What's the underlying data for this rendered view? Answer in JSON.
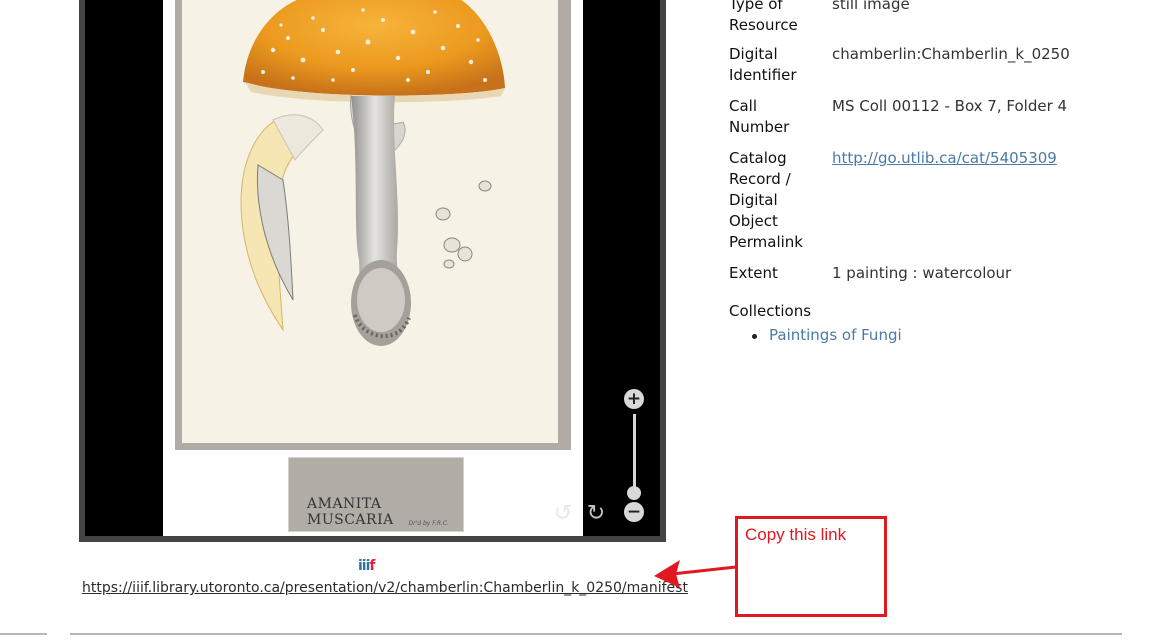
{
  "viewer": {
    "caption": "AMANITA MUSCARIA",
    "signature": "Dr'd by F.R.C.",
    "zoom_in_icon": "plus-icon",
    "zoom_out_icon": "minus-icon",
    "rotate_left_icon": "rotate-left-icon",
    "rotate_right_icon": "rotate-right-icon"
  },
  "iiif": {
    "logo_i": "iii",
    "logo_f": "f",
    "manifest_url": "https://iiif.library.utoronto.ca/presentation/v2/chamberlin:Chamberlin_k_0250/manifest"
  },
  "metadata": [
    {
      "label": "Type of Resource",
      "value": "still image",
      "is_link": false
    },
    {
      "label": "Digital Identifier",
      "value": "chamberlin:Chamberlin_k_0250",
      "is_link": false
    },
    {
      "label": "Call Number",
      "value": "MS Coll 00112 - Box 7, Folder 4",
      "is_link": false
    },
    {
      "label": "Catalog Record / Digital Object Permalink",
      "value": "http://go.utlib.ca/cat/5405309",
      "is_link": true
    },
    {
      "label": "Extent",
      "value": "1 painting : watercolour",
      "is_link": false
    }
  ],
  "collections": {
    "heading": "Collections",
    "items": [
      "Paintings of Fungi"
    ]
  },
  "annotation": {
    "text": "Copy this link",
    "color": "#e0181f"
  }
}
